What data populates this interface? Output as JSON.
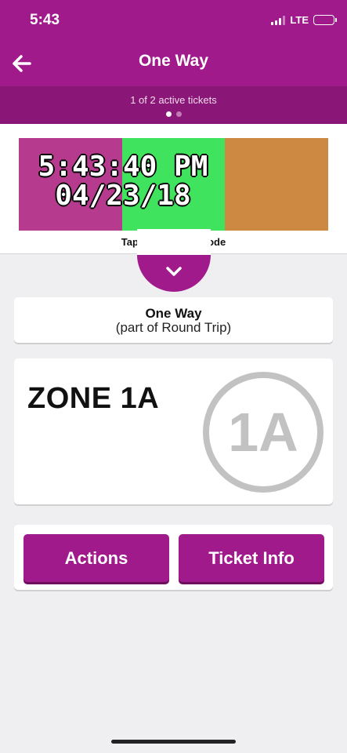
{
  "status_bar": {
    "time": "5:43",
    "network": "LTE",
    "icons": [
      "signal-icon",
      "battery-icon"
    ]
  },
  "nav": {
    "title": "One Way",
    "back_icon": "arrow-left-icon"
  },
  "pager": {
    "label": "1 of 2 active tickets",
    "total": 2,
    "current": 1
  },
  "ticket_visual": {
    "time": "5:43:40 PM",
    "date": "04/23/18",
    "colors": [
      "#b63b8f",
      "#40e35d",
      "#cd8942"
    ],
    "barcode_hint": "Tap to reveal barcode",
    "expand_icon": "chevron-down-icon"
  },
  "trip": {
    "title": "One Way",
    "subtitle": "(part of Round Trip)"
  },
  "zone": {
    "title": "ZONE 1A",
    "badge": "1A"
  },
  "actions": {
    "actions_label": "Actions",
    "ticket_info_label": "Ticket Info"
  },
  "theme": {
    "brand": "#a11a8c",
    "brand_dark": "#8a1677"
  }
}
